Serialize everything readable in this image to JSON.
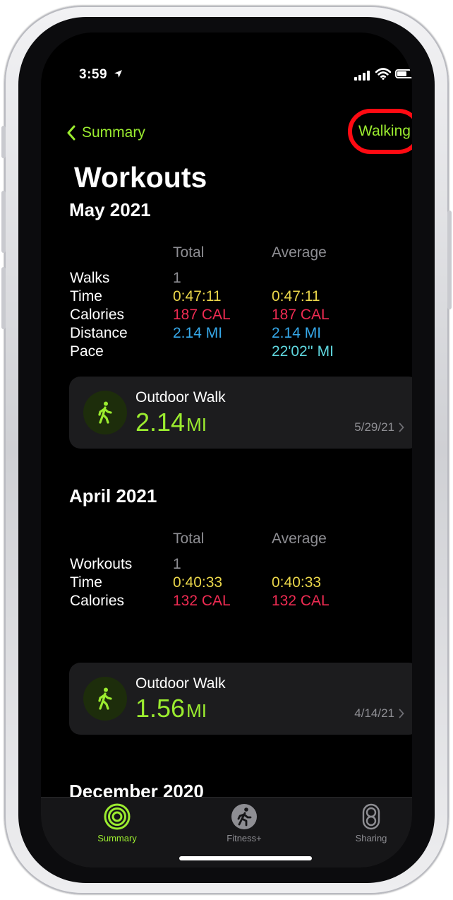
{
  "status": {
    "time": "3:59"
  },
  "nav": {
    "back_label": "Summary",
    "filter_label": "Walking",
    "title": "Workouts"
  },
  "columns": {
    "total": "Total",
    "average": "Average"
  },
  "sections": [
    {
      "month": "May 2021",
      "rows": [
        {
          "label": "Walks",
          "total": "1",
          "average": ""
        },
        {
          "label": "Time",
          "total": "0:47:11",
          "average": "0:47:11"
        },
        {
          "label": "Calories",
          "total": "187 CAL",
          "average": "187 CAL"
        },
        {
          "label": "Distance",
          "total": "2.14 MI",
          "average": "2.14 MI"
        },
        {
          "label": "Pace",
          "total": "",
          "average": "22'02'' MI"
        }
      ],
      "workout": {
        "title": "Outdoor Walk",
        "value": "2.14",
        "unit": "MI",
        "date": "5/29/21"
      }
    },
    {
      "month": "April 2021",
      "rows": [
        {
          "label": "Workouts",
          "total": "1",
          "average": ""
        },
        {
          "label": "Time",
          "total": "0:40:33",
          "average": "0:40:33"
        },
        {
          "label": "Calories",
          "total": "132 CAL",
          "average": "132 CAL"
        }
      ],
      "workout": {
        "title": "Outdoor Walk",
        "value": "1.56",
        "unit": "MI",
        "date": "4/14/21"
      }
    },
    {
      "month": "December 2020"
    }
  ],
  "tabs": [
    {
      "label": "Summary",
      "icon": "activity-rings-icon",
      "active": true
    },
    {
      "label": "Fitness+",
      "icon": "fitness-plus-icon",
      "active": false
    },
    {
      "label": "Sharing",
      "icon": "sharing-icon",
      "active": false
    }
  ],
  "colors": {
    "accent": "#9bec2f",
    "time": "#ead64a",
    "calories": "#ee2b52",
    "distance": "#36a8e9",
    "pace": "#5fd7df",
    "highlight_ring": "#ff0a12"
  }
}
